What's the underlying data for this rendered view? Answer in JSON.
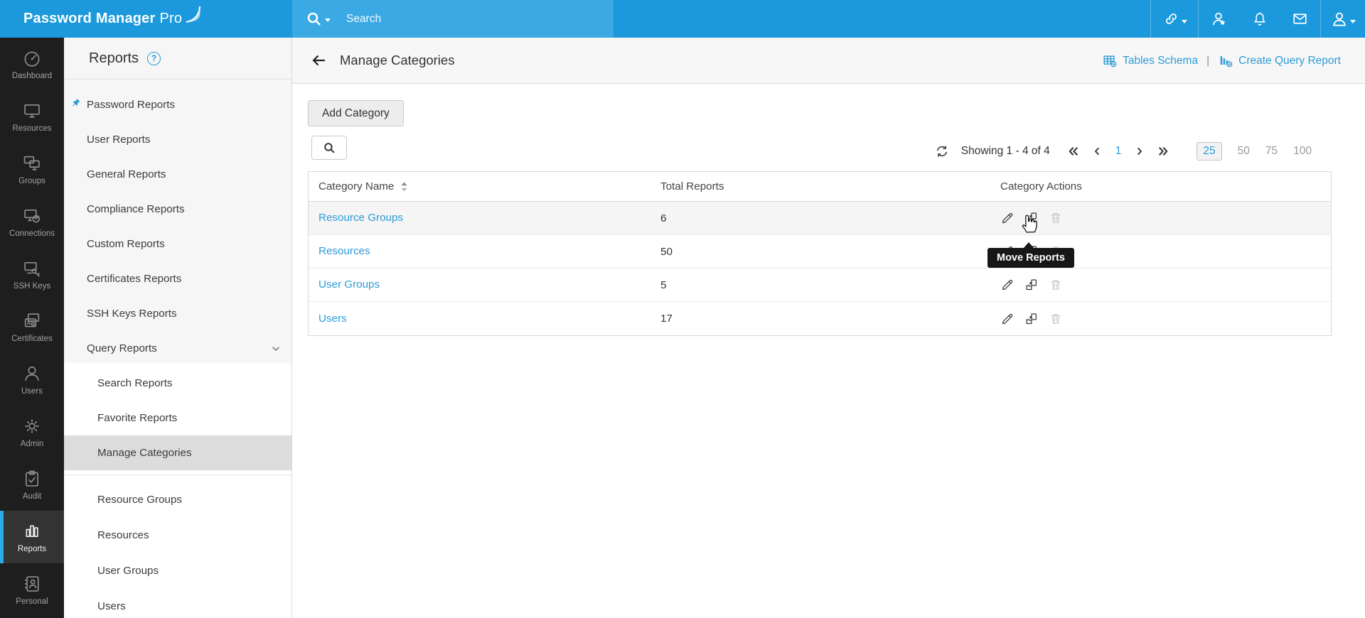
{
  "colors": {
    "topbar": "#1b99dc",
    "search_segment": "#3aa9e4",
    "rail_bg": "#1e1e1e",
    "rail_accent": "#2caae3",
    "panel_gray": "#f6f6f6",
    "active_row": "#dcdcdc",
    "link_blue": "#2d9cd8",
    "tooltip_bg": "#171717"
  },
  "topbar": {
    "logo_bold": "Password Manager",
    "logo_light": "Pro",
    "search_placeholder": "Search",
    "icons": [
      "resource-link-icon",
      "user-star-icon",
      "notification-bell-icon",
      "mail-icon",
      "account-icon"
    ]
  },
  "nav_rail": {
    "items": [
      {
        "label": "Dashboard",
        "icon": "gauge",
        "active": false
      },
      {
        "label": "Resources",
        "icon": "monitor",
        "active": false
      },
      {
        "label": "Groups",
        "icon": "monitors",
        "active": false
      },
      {
        "label": "Connections",
        "icon": "connections",
        "active": false
      },
      {
        "label": "SSH Keys",
        "icon": "sshkeys",
        "active": false
      },
      {
        "label": "Certificates",
        "icon": "certificates",
        "active": false
      },
      {
        "label": "Users",
        "icon": "user",
        "active": false
      },
      {
        "label": "Admin",
        "icon": "gear",
        "active": false
      },
      {
        "label": "Audit",
        "icon": "audit",
        "active": false
      },
      {
        "label": "Reports",
        "icon": "reports",
        "active": true
      },
      {
        "label": "Personal",
        "icon": "personal",
        "active": false
      }
    ]
  },
  "reports_panel": {
    "title": "Reports",
    "help_glyph": "?",
    "items_top": [
      {
        "label": "Password Reports",
        "pinned": true
      },
      {
        "label": "User Reports"
      },
      {
        "label": "General Reports"
      },
      {
        "label": "Compliance Reports"
      },
      {
        "label": "Custom Reports"
      },
      {
        "label": "Certificates Reports"
      },
      {
        "label": "SSH Keys Reports"
      },
      {
        "label": "Query Reports",
        "expanded": true
      }
    ],
    "items_sub": [
      {
        "label": "Search Reports"
      },
      {
        "label": "Favorite Reports"
      },
      {
        "label": "Manage Categories",
        "active": true
      }
    ],
    "items_bottom": [
      {
        "label": "Resource Groups"
      },
      {
        "label": "Resources"
      },
      {
        "label": "User Groups"
      },
      {
        "label": "Users"
      }
    ]
  },
  "header": {
    "title": "Manage Categories",
    "links": [
      {
        "label": "Tables Schema"
      },
      {
        "label": "Create Query Report"
      }
    ],
    "links_separator": "|"
  },
  "toolbar": {
    "add_button": "Add Category"
  },
  "pagination": {
    "summary": "Showing 1 - 4 of 4",
    "current_page": "1",
    "page_sizes": [
      "25",
      "50",
      "75",
      "100"
    ],
    "selected_size": "25"
  },
  "table": {
    "columns": [
      "Category Name",
      "Total Reports",
      "Category Actions"
    ],
    "rows": [
      {
        "name": "Resource Groups",
        "total": "6"
      },
      {
        "name": "Resources",
        "total": "50"
      },
      {
        "name": "User Groups",
        "total": "5"
      },
      {
        "name": "Users",
        "total": "17"
      }
    ],
    "row_actions": [
      "edit",
      "move-reports",
      "delete"
    ]
  },
  "tooltip": {
    "text": "Move Reports"
  }
}
